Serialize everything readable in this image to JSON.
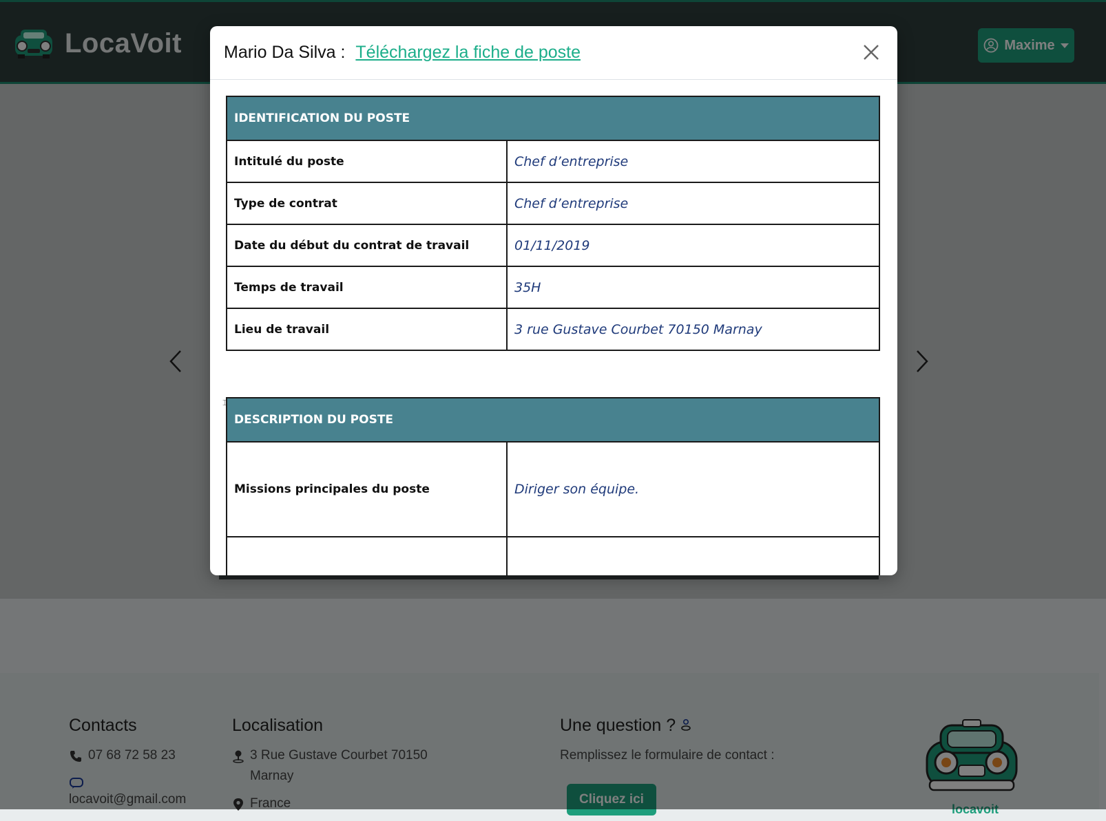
{
  "navbar": {
    "brand": "LocaVoit",
    "logo_caption": "locavoit",
    "user_label": "Maxime"
  },
  "modal": {
    "employee_name": "Mario Da Silva :",
    "download_link": "Téléchargez la fiche de poste",
    "sections": [
      {
        "header": "IDENTIFICATION DU POSTE",
        "rows": [
          {
            "label": "Intitulé du poste",
            "value": "Chef d’entreprise"
          },
          {
            "label": "Type de contrat",
            "value": "Chef d’entreprise"
          },
          {
            "label": "Date du début du contrat de travail",
            "value": "01/11/2019"
          },
          {
            "label": "Temps de travail",
            "value": "35H"
          },
          {
            "label": "Lieu de travail",
            "value": "3 rue Gustave Courbet 70150 Marnay"
          }
        ]
      },
      {
        "header": "DESCRIPTION DU POSTE",
        "rows": [
          {
            "label": "Missions principales du poste",
            "value": "Diriger son équipe."
          }
        ]
      }
    ]
  },
  "footer": {
    "contacts": {
      "title": "Contacts",
      "phone": "07 68 72 58 23",
      "email": "locavoit@gmail.com"
    },
    "location": {
      "title": "Localisation",
      "address": "3 Rue Gustave Courbet 70150 Marnay",
      "country": "France"
    },
    "question": {
      "title": "Une question ?",
      "text": "Remplissez le formulaire de contact :",
      "button": "Cliquez ici"
    },
    "logo_caption": "locavoit"
  },
  "colors": {
    "accent": "#1e9e7c",
    "navbar": "#2e3f3d",
    "table_header": "#48828f",
    "value_text": "#1f3a7a"
  },
  "icons": {
    "user": "user-circle-icon",
    "phone": "phone-icon",
    "email": "chat-icon",
    "pin": "map-pin-icon",
    "location": "location-marker-icon",
    "close": "close-icon",
    "prev": "chevron-left-icon",
    "next": "chevron-right-icon"
  }
}
